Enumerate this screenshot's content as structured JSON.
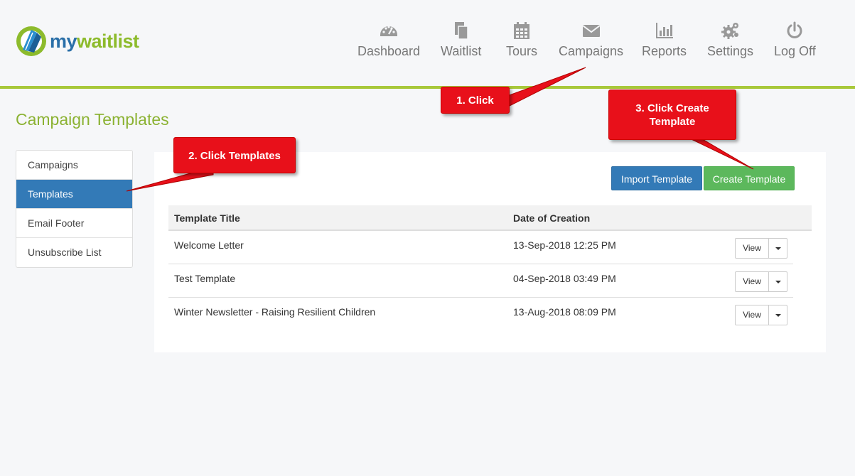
{
  "brand": {
    "logo_my": "my",
    "logo_rest": "waitlist"
  },
  "nav": [
    {
      "label": "Dashboard",
      "icon": "dashboard-icon"
    },
    {
      "label": "Waitlist",
      "icon": "documents-icon"
    },
    {
      "label": "Tours",
      "icon": "calendar-icon"
    },
    {
      "label": "Campaigns",
      "icon": "envelope-icon"
    },
    {
      "label": "Reports",
      "icon": "bar-chart-icon"
    },
    {
      "label": "Settings",
      "icon": "gears-icon"
    },
    {
      "label": "Log Off",
      "icon": "power-icon"
    }
  ],
  "page": {
    "title": "Campaign Templates"
  },
  "sidebar": {
    "items": [
      {
        "label": "Campaigns"
      },
      {
        "label": "Templates",
        "active": true
      },
      {
        "label": "Email Footer"
      },
      {
        "label": "Unsubscribe List"
      }
    ]
  },
  "actions": {
    "import_label": "Import Template",
    "create_label": "Create Template"
  },
  "table": {
    "columns": [
      "Template Title",
      "Date of Creation"
    ],
    "rows": [
      {
        "title": "Welcome Letter",
        "date": "13-Sep-2018 12:25 PM",
        "action": "View"
      },
      {
        "title": "Test Template",
        "date": "04-Sep-2018 03:49 PM",
        "action": "View"
      },
      {
        "title": "Winter Newsletter - Raising Resilient Children",
        "date": "13-Aug-2018 08:09 PM",
        "action": "View"
      }
    ]
  },
  "callouts": {
    "step1": "1. Click",
    "step2": "2. Click Templates",
    "step3_line1": "3. Click Create",
    "step3_line2": "Template"
  },
  "colors": {
    "accent_green": "#a8c83a",
    "title_green": "#8bb232",
    "primary_blue": "#337ab7",
    "success_green": "#5cb85c",
    "callout_red": "#e8101a"
  }
}
